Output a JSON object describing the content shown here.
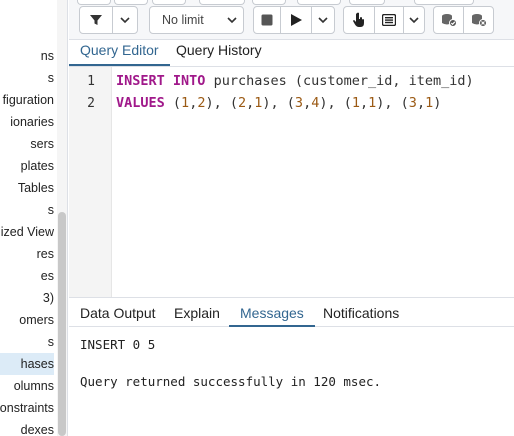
{
  "tree": {
    "items": [
      {
        "label": "ns",
        "selected": false
      },
      {
        "label": "s",
        "selected": false
      },
      {
        "label": "figuration",
        "selected": false
      },
      {
        "label": "ionaries",
        "selected": false
      },
      {
        "label": "sers",
        "selected": false
      },
      {
        "label": "plates",
        "selected": false
      },
      {
        "label": "Tables",
        "selected": false
      },
      {
        "label": "s",
        "selected": false
      },
      {
        "label": "ized View",
        "selected": false
      },
      {
        "label": "res",
        "selected": false
      },
      {
        "label": "es",
        "selected": false
      },
      {
        "label": "3)",
        "selected": false
      },
      {
        "label": "omers",
        "selected": false
      },
      {
        "label": "s",
        "selected": false
      },
      {
        "label": "hases",
        "selected": true
      },
      {
        "label": "olumns",
        "selected": false
      },
      {
        "label": "onstraints",
        "selected": false
      },
      {
        "label": "dexes",
        "selected": false
      }
    ]
  },
  "toolbar": {
    "filter_icon": "filter-icon",
    "limit": {
      "selected": "No limit"
    },
    "stop_icon": "stop-icon",
    "execute_icon": "play-icon",
    "explain_icon": "hand-pointer-icon",
    "macros_icon": "list-icon",
    "commit_icon": "db-commit-icon",
    "rollback_icon": "db-rollback-icon"
  },
  "editor_tabs": [
    {
      "label": "Query Editor",
      "active": true
    },
    {
      "label": "Query History",
      "active": false
    }
  ],
  "editor": {
    "lines": [
      {
        "number": "1",
        "tokens": [
          [
            "kw",
            "INSERT"
          ],
          [
            "txt",
            " "
          ],
          [
            "kw",
            "INTO"
          ],
          [
            "txt",
            " purchases (customer_id, item_id)"
          ]
        ]
      },
      {
        "number": "2",
        "tokens": [
          [
            "kw",
            "VALUES"
          ],
          [
            "txt",
            " ("
          ],
          [
            "num",
            "1"
          ],
          [
            "txt",
            ","
          ],
          [
            "num",
            "2"
          ],
          [
            "txt",
            "), ("
          ],
          [
            "num",
            "2"
          ],
          [
            "txt",
            ","
          ],
          [
            "num",
            "1"
          ],
          [
            "txt",
            "), ("
          ],
          [
            "num",
            "3"
          ],
          [
            "txt",
            ","
          ],
          [
            "num",
            "4"
          ],
          [
            "txt",
            "), ("
          ],
          [
            "num",
            "1"
          ],
          [
            "txt",
            ","
          ],
          [
            "num",
            "1"
          ],
          [
            "txt",
            "), ("
          ],
          [
            "num",
            "3"
          ],
          [
            "txt",
            ","
          ],
          [
            "num",
            "1"
          ],
          [
            "txt",
            ")"
          ]
        ]
      }
    ]
  },
  "results_tabs": [
    {
      "label": "Data Output",
      "active": false
    },
    {
      "label": "Explain",
      "active": false
    },
    {
      "label": "Messages",
      "active": true
    },
    {
      "label": "Notifications",
      "active": false
    }
  ],
  "messages": {
    "line1": "INSERT 0 5",
    "line2": "Query returned successfully in 120 msec."
  },
  "colors": {
    "accent": "#326690",
    "keyword": "#a0188a",
    "number": "#9b5a14",
    "selected_row": "#dcebf7"
  }
}
